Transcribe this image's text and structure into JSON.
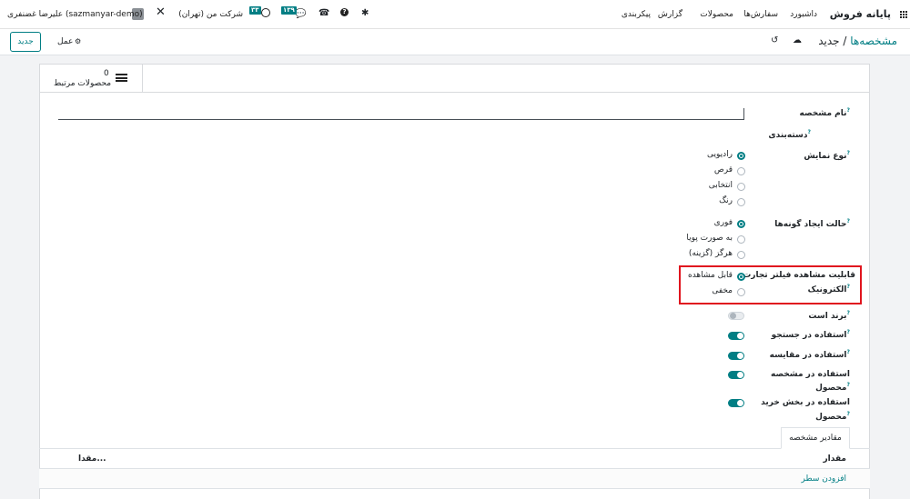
{
  "topbar": {
    "brand": "پایانه فروش",
    "menu": [
      "داشبورد",
      "سفارش‌ها",
      "محصولات",
      "گزارش",
      "پیکربندی"
    ],
    "company": "شرکت من (تهران)",
    "user": "علیرضا غضنفری (sazmanyar-demo)",
    "activity_badge": "۳۳",
    "chat_badge": "۱۳۹"
  },
  "control_panel": {
    "breadcrumb_parent": "مشخصه‌ها",
    "breadcrumb_sep": "/",
    "breadcrumb_current": "جدید",
    "action_label": "عمل",
    "new_button": "جدید"
  },
  "stat_button": {
    "count": "0",
    "label": "محصولات مرتبط"
  },
  "form": {
    "name_label": "نام مشخصه",
    "category_label": "دسته‌بندی",
    "display_type": {
      "label": "نوع نمایش",
      "options": [
        "رادیویی",
        "قرص",
        "انتخابی",
        "رنگ"
      ],
      "selected": 0
    },
    "create_variant": {
      "label": "حالت ایجاد گونه‌ها",
      "options": [
        "فوری",
        "به صورت پویا",
        "هرگز (گزینه)"
      ],
      "selected": 0
    },
    "ecommerce_filter": {
      "label_line1": "قابلیت مشاهده فیلتر تجارت",
      "label_line2": "الکترونیک",
      "options": [
        "قابل مشاهده",
        "مخفی"
      ],
      "selected": 0
    },
    "is_brand": {
      "label": "برند است",
      "on": false
    },
    "use_in_search": {
      "label": "استفاده در جستجو",
      "on": true
    },
    "use_in_compare": {
      "label": "استفاده در مقایسه",
      "on": true
    },
    "use_in_spec": {
      "label_line1": "استفاده در مشخصه",
      "label_line2": "محصول",
      "on": true
    },
    "use_in_purchase": {
      "label_line1": "استفاده در بخش خرید",
      "label_line2": "محصول",
      "on": true
    }
  },
  "notebook": {
    "tab_label": "مقادیر مشخصه",
    "columns": [
      "مقدار",
      "مقدا..."
    ],
    "add_line": "افزودن سطر"
  },
  "colors": {
    "accent": "#017e84",
    "highlight": "#e0151e"
  }
}
